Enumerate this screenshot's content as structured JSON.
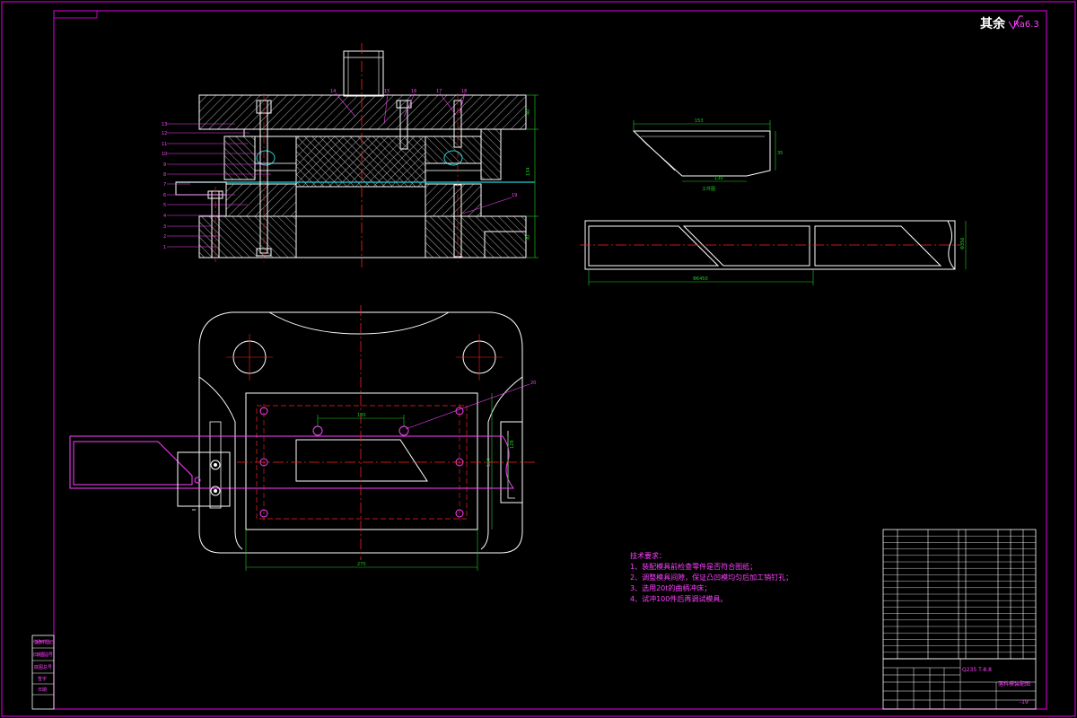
{
  "colors": {
    "background": "#000000",
    "frame": "#c000c0",
    "outline": "#ffffff",
    "center": "#ff2020",
    "dimension": "#20d020",
    "note": "#ff40ff",
    "hatch": "#ffffff",
    "leader": "#ff40ff"
  },
  "header": {
    "roughness_word": "其余",
    "roughness_value": "Ra6.3"
  },
  "section_view": {
    "part_numbers_left": [
      "13",
      "12",
      "11",
      "10",
      "9",
      "8",
      "7",
      "6",
      "5",
      "4",
      "3",
      "2",
      "1"
    ],
    "part_numbers_top": [
      "14",
      "15",
      "16",
      "17",
      "18"
    ],
    "callout_right": "19",
    "dim_top_h": "40",
    "dim_total_h": "134",
    "dim_bottom_h": "30"
  },
  "workpiece": {
    "dim_top": "153",
    "dim_bottom": "130",
    "dim_side": "35",
    "label": "工件图"
  },
  "strip": {
    "dim_length": "Φ6450",
    "dim_width": "Φ356"
  },
  "plan_view": {
    "callout": "20",
    "dim_holes": "100",
    "dim_width": "270",
    "dim_height": "164",
    "dim_inner": "128"
  },
  "notes": {
    "title": "技术要求：",
    "items": [
      "1、装配模具前检查零件是否符合图纸；",
      "2、调整模具间隙，保证凸凹模均匀后加工销钉孔；",
      "3、选用20t的曲柄冲床；",
      "4、试冲100件后再调试模具。"
    ]
  },
  "title_block": {
    "material": "Q235 T-8.8",
    "drawing_name": "落料模装配图",
    "sheet": "-19"
  },
  "side_strip": {
    "labels": [
      "借(通)用件登记",
      "旧底图总号",
      "底图总号",
      "签字",
      "日期"
    ]
  }
}
